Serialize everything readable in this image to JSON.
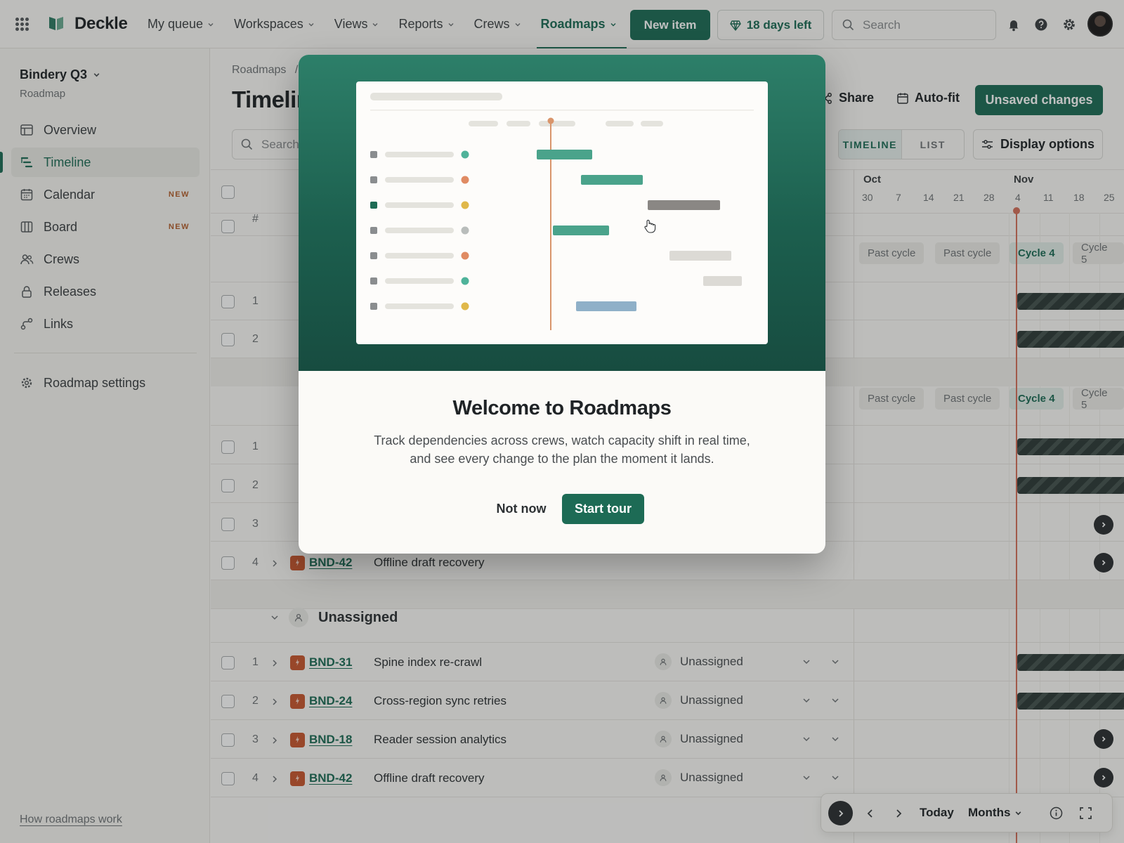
{
  "app": {
    "brand": "Deckle",
    "nav": [
      {
        "label": "My queue"
      },
      {
        "label": "Workspaces"
      },
      {
        "label": "Views"
      },
      {
        "label": "Reports"
      },
      {
        "label": "Crews"
      },
      {
        "label": "Roadmaps",
        "active": true
      }
    ],
    "new_item_label": "New item",
    "trial_label": "18 days left",
    "search_placeholder": "Search",
    "accent_color": "#1d6b55"
  },
  "sidebar": {
    "workspace_name": "Bindery Q3",
    "workspace_type": "Roadmap",
    "items": [
      {
        "label": "Overview",
        "icon": "overview-icon"
      },
      {
        "label": "Timeline",
        "icon": "timeline-icon",
        "active": true
      },
      {
        "label": "Calendar",
        "icon": "calendar-icon",
        "badge": "NEW"
      },
      {
        "label": "Board",
        "icon": "board-icon",
        "badge": "NEW"
      },
      {
        "label": "Crews",
        "icon": "crews-icon"
      },
      {
        "label": "Releases",
        "icon": "releases-icon"
      },
      {
        "label": "Links",
        "icon": "links-icon"
      }
    ],
    "settings_label": "Roadmap settings",
    "help_link": "How roadmaps work"
  },
  "main": {
    "breadcrumb": "Roadmaps",
    "breadcrumb_sep": "/",
    "title": "Timelin",
    "search_placeholder": "Search",
    "share_label": "Share",
    "autofit_label": "Auto-fit",
    "unsaved_label": "Unsaved changes",
    "view_tabs": [
      "TIMELINE",
      "LIST"
    ],
    "display_options_label": "Display options",
    "hash_header": "#",
    "timeline": {
      "months": [
        "Oct",
        "Nov"
      ],
      "weeks": [
        "30",
        "7",
        "14",
        "21",
        "28",
        "4",
        "11",
        "18",
        "25"
      ],
      "cycles": [
        "Past cycle",
        "Past cycle",
        "Cycle 4",
        "Cycle 5"
      ]
    },
    "partial_rows": [
      {
        "num": "1"
      },
      {
        "num": "2"
      },
      {
        "num": "1"
      },
      {
        "num": "2"
      },
      {
        "num": "3"
      }
    ],
    "visible_row": {
      "num": "4",
      "key": "BND-42",
      "title": "Offline draft recovery"
    },
    "unassigned_group": {
      "name": "Unassigned",
      "rows": [
        {
          "num": "1",
          "key": "BND-31",
          "title": "Spine index re-crawl",
          "assignee": "Unassigned"
        },
        {
          "num": "2",
          "key": "BND-24",
          "title": "Cross-region sync retries",
          "assignee": "Unassigned"
        },
        {
          "num": "3",
          "key": "BND-18",
          "title": "Reader session analytics",
          "assignee": "Unassigned"
        },
        {
          "num": "4",
          "key": "BND-42",
          "title": "Offline draft recovery",
          "assignee": "Unassigned"
        }
      ]
    },
    "toolbar": {
      "today_label": "Today",
      "scale_label": "Months"
    }
  },
  "modal": {
    "title": "Welcome to Roadmaps",
    "body": "Track dependencies across crews, watch capacity shift in real time, and see every change to the plan the moment it lands.",
    "secondary_label": "Not now",
    "primary_label": "Start tour"
  }
}
